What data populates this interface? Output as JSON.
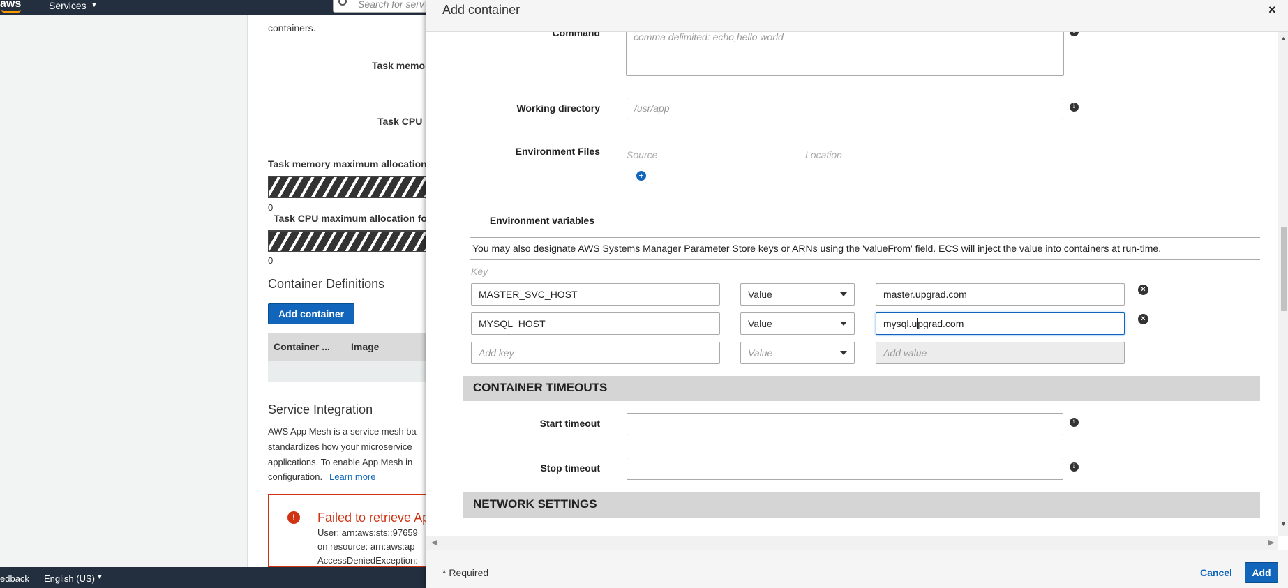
{
  "nav": {
    "logo": "aws",
    "services": "Services",
    "search_placeholder": "Search for serv"
  },
  "background": {
    "containers_text": "containers.",
    "task_memory_label": "Task memo",
    "task_cpu_label": "Task CPU",
    "mem_max_alloc": "Task memory maximum allocation",
    "cpu_max_alloc": "Task CPU maximum allocation fo",
    "zero": "0",
    "container_definitions": "Container Definitions",
    "add_container_button": "Add container",
    "col_container": "Container ...",
    "col_image": "Image",
    "service_integration": "Service Integration",
    "svc_line1": "AWS App Mesh is a service mesh ba",
    "svc_line2": "standardizes how your microservice",
    "svc_line3": "applications. To enable App Mesh in",
    "svc_line4": "configuration.",
    "learn_more": "Learn more",
    "error_title": "Failed to retrieve Ap",
    "error_line1": "User: arn:aws:sts::97659",
    "error_line2": "on resource: arn:aws:ap",
    "error_line3": "AccessDeniedException:",
    "footer_feedback": "edback",
    "footer_language": "English (US)"
  },
  "modal": {
    "title": "Add container",
    "close": "×",
    "command": {
      "label": "Command",
      "placeholder": "comma delimited: echo,hello world"
    },
    "working_directory": {
      "label": "Working directory",
      "placeholder": "/usr/app"
    },
    "environment_files": {
      "label": "Environment Files",
      "col_source": "Source",
      "col_location": "Location"
    },
    "environment_variables": {
      "label": "Environment variables",
      "note": "You may also designate AWS Systems Manager Parameter Store keys or ARNs using the 'valueFrom' field. ECS will inject the value into containers at run-time.",
      "col_key": "Key",
      "rows": [
        {
          "key": "MASTER_SVC_HOST",
          "type": "Value",
          "value": "master.upgrad.com"
        },
        {
          "key": "MYSQL_HOST",
          "type": "Value",
          "value_before_cursor": "mysql.u",
          "value_after_cursor": "pgrad.com"
        }
      ],
      "new_row": {
        "key_placeholder": "Add key",
        "type": "Value",
        "value_placeholder": "Add value"
      }
    },
    "container_timeouts": {
      "section": "CONTAINER TIMEOUTS",
      "start_label": "Start timeout",
      "start_value": "",
      "stop_label": "Stop timeout",
      "stop_value": ""
    },
    "network_settings": {
      "section": "NETWORK SETTINGS"
    },
    "footer": {
      "required": "* Required",
      "cancel": "Cancel",
      "add": "Add"
    }
  },
  "colors": {
    "nav_bg": "#232f3e",
    "primary_blue": "#1166bb",
    "error_red": "#d13212",
    "section_gray": "#d5d5d5"
  }
}
